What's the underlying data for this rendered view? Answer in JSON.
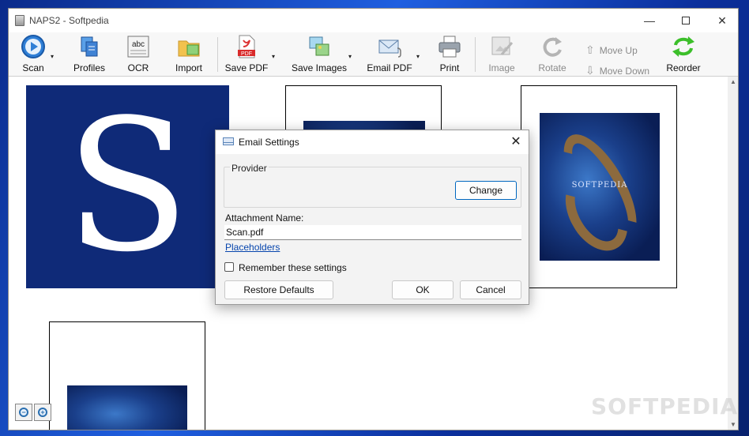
{
  "window": {
    "title": "NAPS2 - Softpedia"
  },
  "window_controls": {
    "minimize": "—",
    "maximize": "",
    "close": "✕"
  },
  "toolbar": {
    "items": [
      {
        "label": "Scan",
        "icon": "scan-icon"
      },
      {
        "label": "Profiles",
        "icon": "profiles-icon"
      },
      {
        "label": "OCR",
        "icon": "ocr-icon"
      },
      {
        "label": "Import",
        "icon": "import-folder-icon"
      },
      {
        "label": "Save PDF",
        "icon": "save-pdf-icon"
      },
      {
        "label": "Save Images",
        "icon": "save-images-icon"
      },
      {
        "label": "Email PDF",
        "icon": "email-pdf-icon"
      },
      {
        "label": "Print",
        "icon": "printer-icon"
      },
      {
        "label": "Image",
        "icon": "image-edit-icon"
      },
      {
        "label": "Rotate",
        "icon": "rotate-icon"
      },
      {
        "label": "Move Up",
        "icon": "arrow-up-icon"
      },
      {
        "label": "Move Down",
        "icon": "arrow-down-icon"
      },
      {
        "label": "Reorder",
        "icon": "reorder-icon"
      }
    ],
    "dropdown_glyph": "▾",
    "ocr_glyph": "abc",
    "pdf_glyph": "PDF"
  },
  "thumbnails": {
    "big_letter": "S",
    "poster_text": "SOFTPEDIA"
  },
  "zoom": {
    "out_glyph": "−",
    "in_glyph": "+"
  },
  "watermark": "SOFTPEDIA",
  "dialog": {
    "title": "Email Settings",
    "close_glyph": "✕",
    "provider_group_label": "Provider",
    "change_button": "Change",
    "attachment_label": "Attachment Name:",
    "attachment_value": "Scan.pdf",
    "placeholders_link": "Placeholders",
    "remember_label": "Remember these settings",
    "remember_checked": false,
    "restore_button": "Restore Defaults",
    "ok_button": "OK",
    "cancel_button": "Cancel"
  },
  "colors": {
    "accent": "#0067c0",
    "scan_blue": "#2f7fd6",
    "thumb_navy": "#0f2a78",
    "reorder_green": "#3cbf2a"
  }
}
